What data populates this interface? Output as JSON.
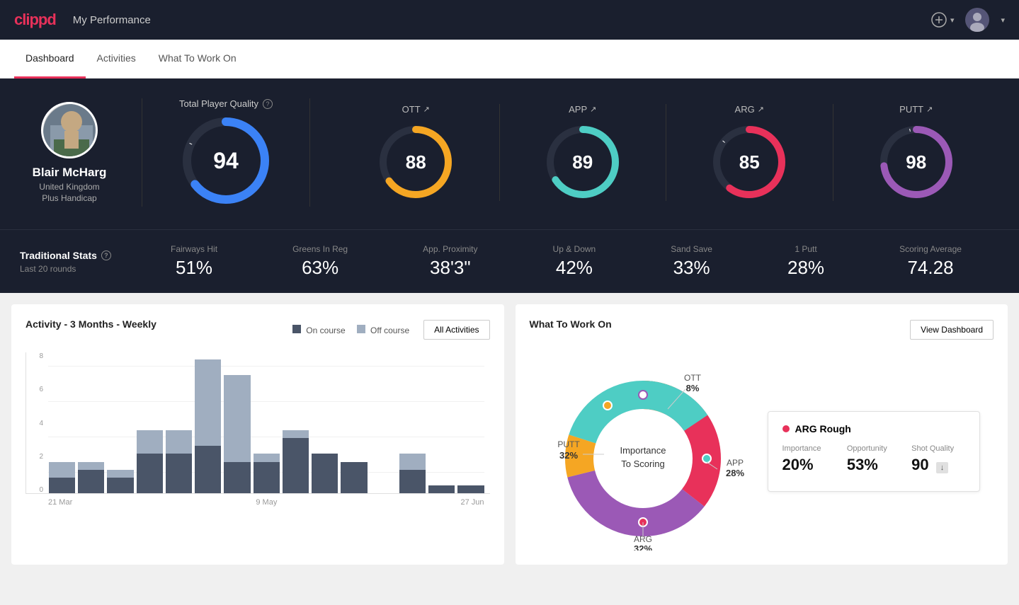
{
  "app": {
    "logo": "clippd",
    "header_title": "My Performance",
    "add_button_label": "+",
    "user_dropdown": "▾"
  },
  "nav": {
    "tabs": [
      {
        "label": "Dashboard",
        "active": true
      },
      {
        "label": "Activities",
        "active": false
      },
      {
        "label": "What To Work On",
        "active": false
      }
    ]
  },
  "player": {
    "name": "Blair McHarg",
    "country": "United Kingdom",
    "handicap": "Plus Handicap"
  },
  "total_quality": {
    "label": "Total Player Quality",
    "value": 94,
    "scores": [
      {
        "id": "ott",
        "label": "OTT",
        "value": 88,
        "color": "#f5a623"
      },
      {
        "id": "app",
        "label": "APP",
        "value": 89,
        "color": "#4ecdc4"
      },
      {
        "id": "arg",
        "label": "ARG",
        "value": 85,
        "color": "#e8315a"
      },
      {
        "id": "putt",
        "label": "PUTT",
        "value": 98,
        "color": "#9b59b6"
      }
    ]
  },
  "traditional_stats": {
    "title": "Traditional Stats",
    "period": "Last 20 rounds",
    "stats": [
      {
        "name": "Fairways Hit",
        "value": "51%"
      },
      {
        "name": "Greens In Reg",
        "value": "63%"
      },
      {
        "name": "App. Proximity",
        "value": "38'3\""
      },
      {
        "name": "Up & Down",
        "value": "42%"
      },
      {
        "name": "Sand Save",
        "value": "33%"
      },
      {
        "name": "1 Putt",
        "value": "28%"
      },
      {
        "name": "Scoring Average",
        "value": "74.28"
      }
    ]
  },
  "activity_chart": {
    "title": "Activity - 3 Months - Weekly",
    "legend_on": "On course",
    "legend_off": "Off course",
    "all_activities_btn": "All Activities",
    "y_labels": [
      "0",
      "2",
      "4",
      "6",
      "8"
    ],
    "x_labels": [
      "21 Mar",
      "9 May",
      "27 Jun"
    ],
    "bars": [
      {
        "on": 1,
        "off": 1
      },
      {
        "on": 1.5,
        "off": 0.5
      },
      {
        "on": 1,
        "off": 0.5
      },
      {
        "on": 2.5,
        "off": 1.5
      },
      {
        "on": 2.5,
        "off": 1.5
      },
      {
        "on": 3,
        "off": 5.5
      },
      {
        "on": 2,
        "off": 5.5
      },
      {
        "on": 2,
        "off": 0.5
      },
      {
        "on": 3.5,
        "off": 0.5
      },
      {
        "on": 2.5,
        "off": 0
      },
      {
        "on": 2,
        "off": 0
      },
      {
        "on": 0,
        "off": 0
      },
      {
        "on": 1.5,
        "off": 1
      },
      {
        "on": 0.5,
        "off": 0
      },
      {
        "on": 0.5,
        "off": 0
      }
    ]
  },
  "what_to_work_on": {
    "title": "What To Work On",
    "view_dashboard_btn": "View Dashboard",
    "donut_center_line1": "Importance",
    "donut_center_line2": "To Scoring",
    "segments": [
      {
        "label": "OTT",
        "percent": "8%",
        "color": "#f5a623"
      },
      {
        "label": "APP",
        "percent": "28%",
        "color": "#4ecdc4"
      },
      {
        "label": "ARG",
        "percent": "32%",
        "color": "#e8315a"
      },
      {
        "label": "PUTT",
        "percent": "32%",
        "color": "#9b59b6"
      }
    ],
    "info_card": {
      "title": "ARG Rough",
      "dot_color": "#e8315a",
      "metrics": [
        {
          "name": "Importance",
          "value": "20%"
        },
        {
          "name": "Opportunity",
          "value": "53%"
        },
        {
          "name": "Shot Quality",
          "value": "90",
          "badge": "↓"
        }
      ]
    }
  }
}
